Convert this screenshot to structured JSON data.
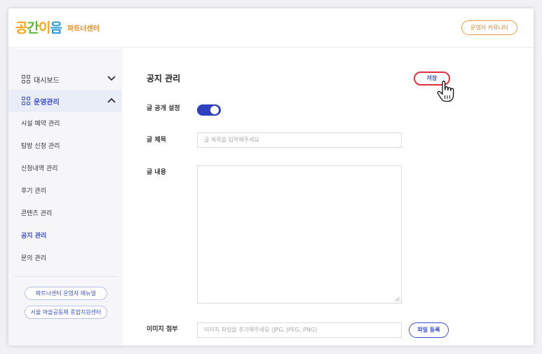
{
  "header": {
    "logo_text": [
      "공",
      "간",
      "이",
      "음"
    ],
    "logo_sub": "파트너센터",
    "community_button": "운영자 커뮤니티"
  },
  "sidebar": {
    "dashboard": "대시보드",
    "operations": "운영관리",
    "sub_items": [
      "시설 예약 관리",
      "탐방 신청 관리",
      "신청내역 관리",
      "후기 관리",
      "콘텐츠 관리",
      "공지 관리",
      "문의 관리"
    ],
    "current_item": "공지 관리",
    "links": [
      "파트너센터 운영자 매뉴얼",
      "서울 마을공동체 종합지원센터"
    ]
  },
  "main": {
    "title": "공지 관리",
    "save_button": "저장",
    "publish_label": "글 공개 설정",
    "publish_on": true,
    "title_label": "글 제목",
    "title_placeholder": "글 제목을 입력해주세요",
    "content_label": "글 내용",
    "image_label": "이미지 첨부",
    "image_placeholder": "이미지 파일을 추가해주세요 (JPG, JPEG, PNG)",
    "file_button": "파일 등록"
  },
  "colors": {
    "accent": "#3b4fd1",
    "toggle": "#2e3fbf",
    "save_border": "#e0303f",
    "community_border": "#f29a45"
  }
}
